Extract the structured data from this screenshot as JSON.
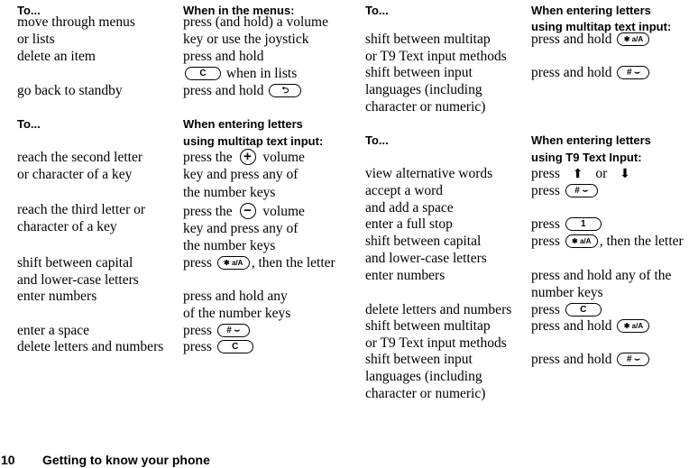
{
  "page": {
    "number": "10",
    "section_title": "Getting to know your phone"
  },
  "keys": {
    "c": "C",
    "back": "⮌",
    "plus": "+",
    "minus": "−",
    "star": "✱ a/A",
    "hash": "# ⌣",
    "one": "1",
    "up_arrow": "⬆",
    "down_arrow": "⬇"
  },
  "menus_table": {
    "col1_header": "To...",
    "col2_header": "When in the menus:",
    "rows": [
      {
        "action": [
          "move through menus",
          "or lists"
        ],
        "instruction": [
          "press (and hold) a volume",
          "key or use the joystick"
        ]
      },
      {
        "action": [
          "delete an item"
        ],
        "instruction_a": "press and hold",
        "instruction_b": "when in lists"
      },
      {
        "action": [
          "go back to standby"
        ],
        "instruction": "press and hold"
      }
    ]
  },
  "multitap_table": {
    "col1_header": "To...",
    "col2_header": [
      "When entering letters",
      "using multitap text input:"
    ],
    "rows": [
      {
        "action": [
          "reach the second letter",
          "or character of a key"
        ],
        "instruction": [
          "press the",
          "volume",
          "key and press any of",
          "the number keys"
        ]
      },
      {
        "action": [
          "reach the third letter or",
          "character of a key"
        ],
        "instruction": [
          "press the",
          "volume",
          "key and press any of",
          "the number keys"
        ]
      },
      {
        "action": [
          "shift between capital",
          "and lower-case letters"
        ],
        "instruction": [
          "press",
          ", then the letter"
        ]
      },
      {
        "action": [
          "enter numbers"
        ],
        "instruction": [
          "press and hold any",
          "of the number keys"
        ]
      },
      {
        "action": [
          "enter a space"
        ],
        "instruction": [
          "press"
        ]
      },
      {
        "action": [
          "delete letters and numbers"
        ],
        "instruction": [
          "press"
        ]
      }
    ]
  },
  "multitap_table_cont": {
    "col1_header": "To...",
    "col2_header": [
      "When entering letters",
      "using multitap text input:"
    ],
    "rows": [
      {
        "action": [
          "shift between multitap",
          "or T9 Text input methods"
        ],
        "instruction": [
          "press and hold"
        ]
      },
      {
        "action": [
          "shift between input",
          "languages (including",
          "character or numeric)"
        ],
        "instruction": [
          "press and hold"
        ]
      }
    ]
  },
  "t9_table": {
    "col1_header": "To...",
    "col2_header": [
      "When entering letters",
      "using T9 Text Input:"
    ],
    "rows": [
      {
        "action": [
          "view alternative words"
        ],
        "instruction": [
          "press",
          "or"
        ]
      },
      {
        "action": [
          "accept a word",
          "and add a space"
        ],
        "instruction": [
          "press"
        ]
      },
      {
        "action": [
          "enter a full stop"
        ],
        "instruction": [
          "press"
        ]
      },
      {
        "action": [
          "shift between capital",
          "and lower-case letters"
        ],
        "instruction": [
          "press",
          ", then the letter"
        ]
      },
      {
        "action": [
          "enter numbers"
        ],
        "instruction": [
          "press and hold any of the",
          "number keys"
        ]
      },
      {
        "action": [
          "delete letters and numbers"
        ],
        "instruction": [
          "press"
        ]
      },
      {
        "action": [
          "shift between multitap",
          "or T9 Text input methods"
        ],
        "instruction": [
          "press and hold"
        ]
      },
      {
        "action": [
          "shift between input",
          "languages (including",
          "character or numeric)"
        ],
        "instruction": [
          "press and hold"
        ]
      }
    ]
  }
}
